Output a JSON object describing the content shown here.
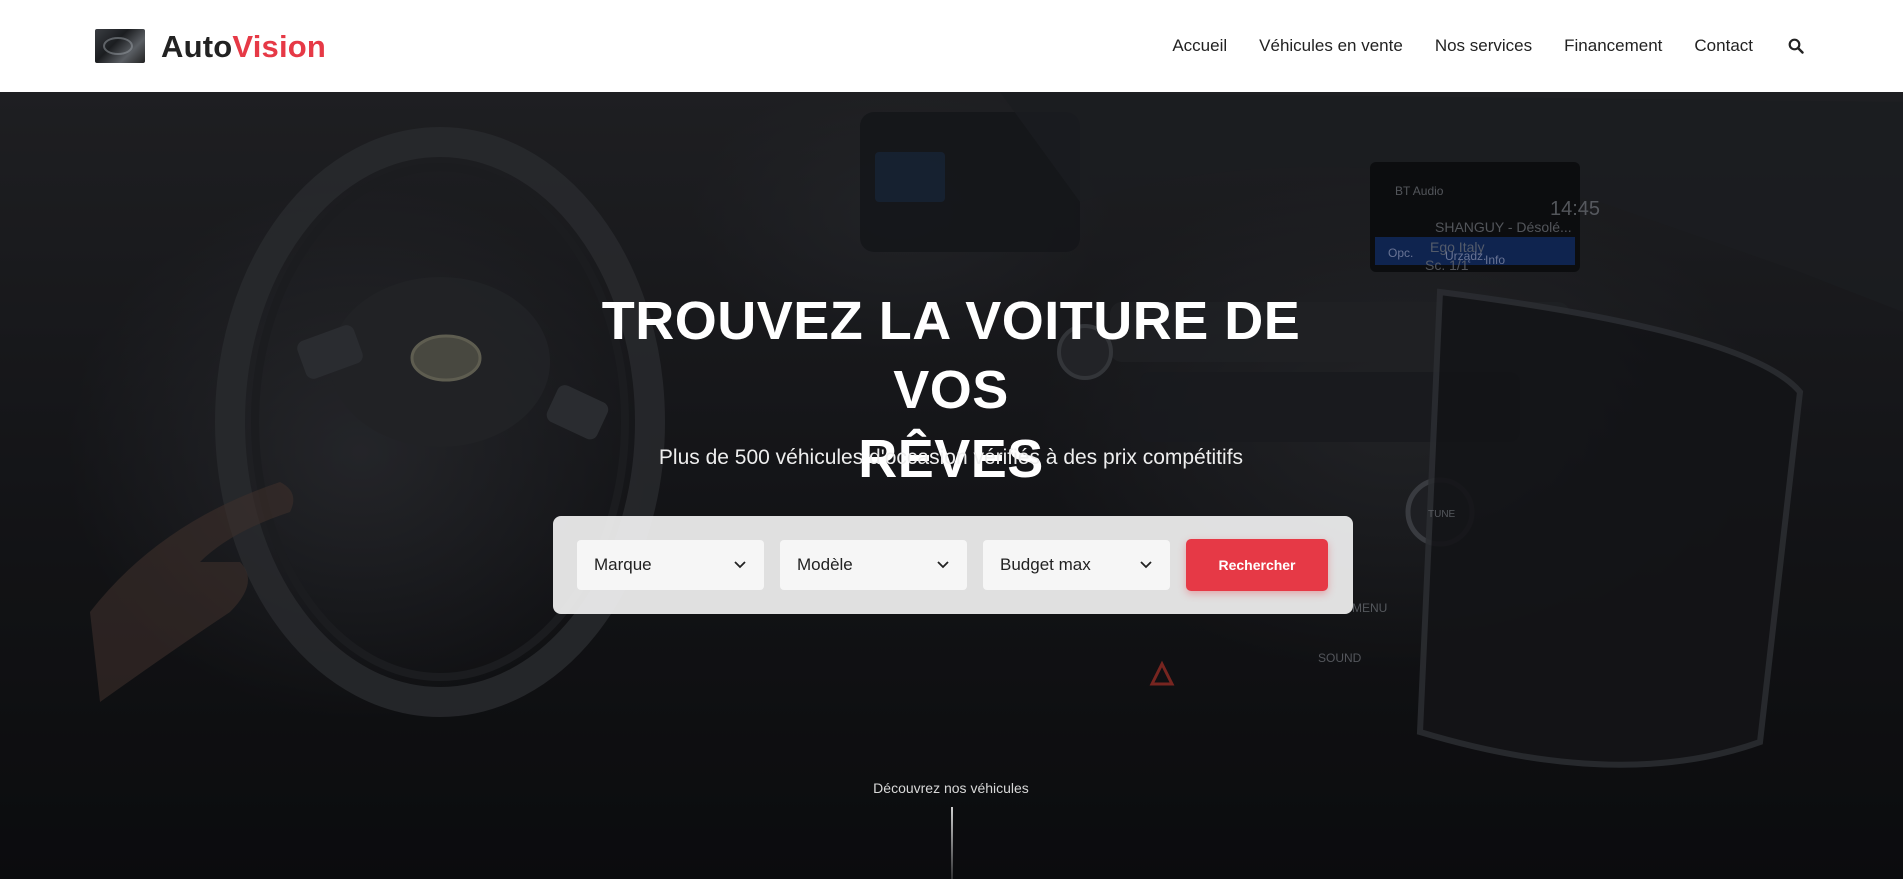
{
  "brand": {
    "part1": "Auto",
    "part2": "Vision",
    "accent_color": "#e63946"
  },
  "nav": {
    "items": [
      {
        "label": "Accueil"
      },
      {
        "label": "Véhicules en vente"
      },
      {
        "label": "Nos services"
      },
      {
        "label": "Financement"
      },
      {
        "label": "Contact"
      }
    ],
    "search_icon": "search-icon"
  },
  "hero": {
    "title_line1": "TROUVEZ LA VOITURE DE VOS",
    "title_line2": "RÊVES",
    "subtitle": "Plus de 500 véhicules d'occasion vérifiés à des prix compétitifs",
    "dashboard_text": {
      "bt": "BT Audio",
      "time": "14:45",
      "track": "SHANGUY - Désolé...",
      "artist": "Ego Italy",
      "sc": "Sc. 1/1",
      "btns": [
        "Opc.",
        "Urządz.",
        "Info"
      ],
      "menu": "MENU",
      "sound": "SOUND",
      "tune": "TUNE"
    }
  },
  "search": {
    "brand_select": "Marque",
    "model_select": "Modèle",
    "budget_select": "Budget max",
    "submit_label": "Rechercher"
  },
  "scroll_hint": {
    "label": "Découvrez nos véhicules"
  }
}
